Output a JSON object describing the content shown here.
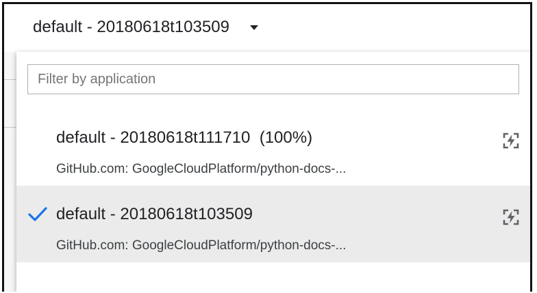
{
  "version_selector": {
    "current": "default - 20180618t103509"
  },
  "dropdown": {
    "filter_placeholder": "Filter by application",
    "filter_value": "",
    "items": [
      {
        "title": "default - 20180618t111710  (100%)",
        "source": "GitHub.com: GoogleCloudPlatform/python-docs-...",
        "selected": false,
        "icon": "flash-on-icon"
      },
      {
        "title": "default - 20180618t103509",
        "source": "GitHub.com: GoogleCloudPlatform/python-docs-...",
        "selected": true,
        "icon": "flash-on-icon"
      }
    ]
  },
  "colors": {
    "check": "#1a73e8",
    "selected_row": "#ebebeb",
    "text": "#202124",
    "icon": "#5f6368"
  }
}
